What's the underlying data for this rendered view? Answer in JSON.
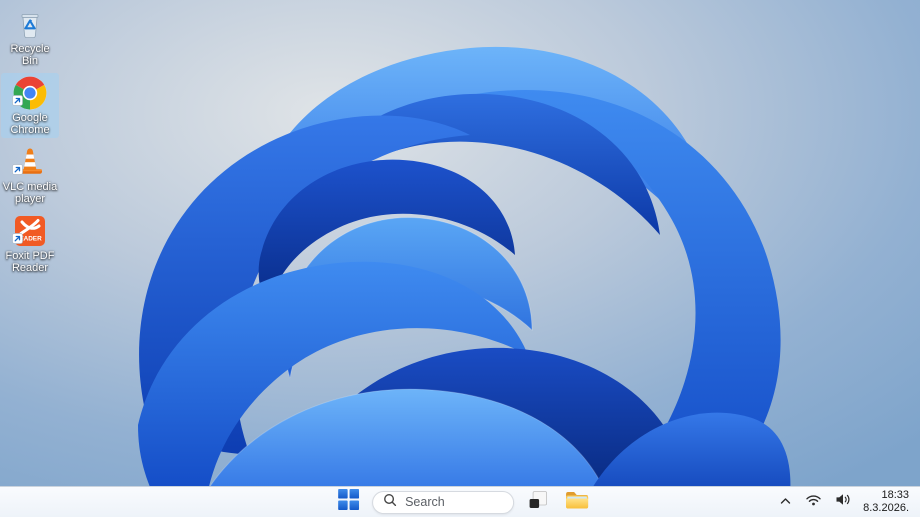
{
  "desktop": {
    "icons": [
      {
        "label": "Recycle Bin",
        "icon": "recycle-bin-icon",
        "shortcut": false,
        "selected": false
      },
      {
        "label": "Google Chrome",
        "icon": "chrome-icon",
        "shortcut": true,
        "selected": true
      },
      {
        "label": "VLC media player",
        "icon": "vlc-cone-icon",
        "shortcut": true,
        "selected": false
      },
      {
        "label": "Foxit PDF Reader",
        "icon": "foxit-icon",
        "shortcut": true,
        "selected": false,
        "icon_text": "EADER"
      }
    ],
    "wallpaper": "windows-11-bloom"
  },
  "taskbar": {
    "search": {
      "placeholder": "Search",
      "icon": "magnifier"
    },
    "buttons": [
      {
        "name": "start",
        "icon": "windows-logo"
      },
      {
        "name": "task-view",
        "icon": "overlapping-squares"
      },
      {
        "name": "file-explorer",
        "icon": "yellow-folder"
      }
    ],
    "tray": {
      "chevron_icon": "chevron-up",
      "network_icon": "wifi-arcs",
      "volume_icon": "speaker-waves",
      "time": "18:33",
      "date": "8.3.2026."
    }
  },
  "colors": {
    "bloom_bright": "#6db4f9",
    "bloom_mid": "#2a6ce2",
    "bloom_dark": "#072a86",
    "background_light": "#dee3e7",
    "background_edge": "#7ea4cb",
    "taskbar_bg": "#f3f7fb",
    "selection_highlight": "#a5d0f0",
    "windows_blue": "#2e74e0"
  }
}
